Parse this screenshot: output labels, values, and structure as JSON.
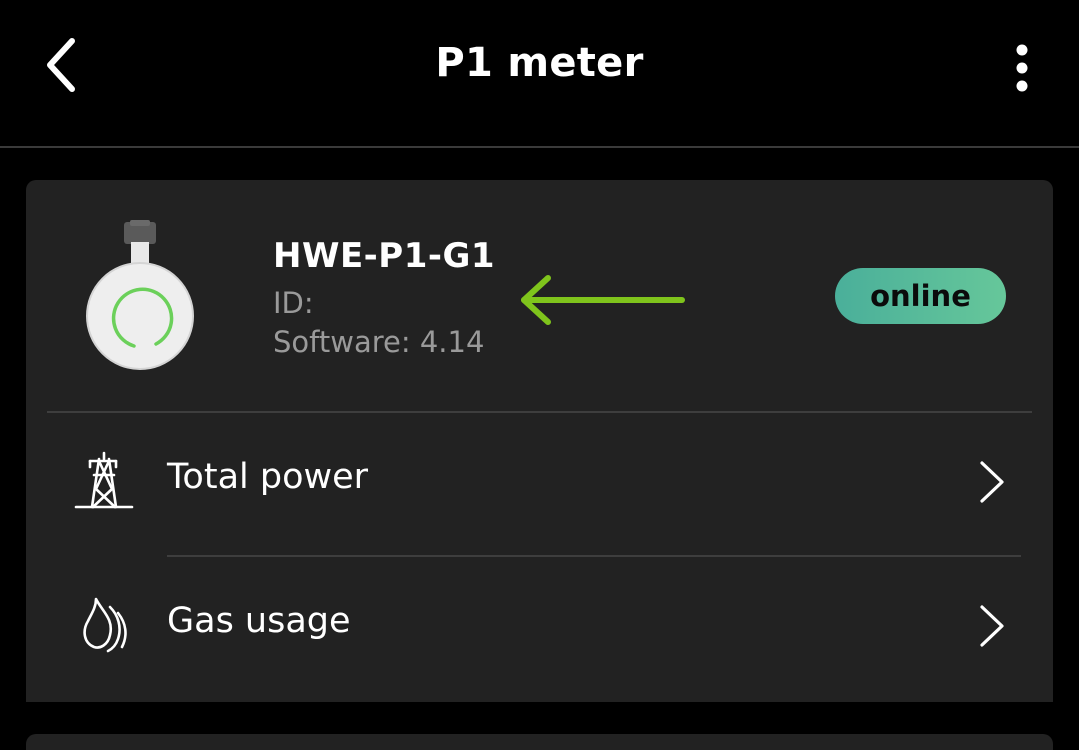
{
  "header": {
    "title": "P1 meter",
    "back_icon": "chevron-left-icon",
    "menu_icon": "more-vertical-icon"
  },
  "device": {
    "name": "HWE-P1-G1",
    "id_label": "ID:",
    "software_label": "Software: 4.14",
    "status": "online",
    "image_icon": "p1-meter-dongle-icon"
  },
  "rows": [
    {
      "label": "Total power",
      "icon": "power-pylon-icon"
    },
    {
      "label": "Gas usage",
      "icon": "gas-flame-icon"
    }
  ],
  "colors": {
    "background": "#000000",
    "card": "#222222",
    "status_badge_start": "#4aaf9a",
    "status_badge_end": "#66c79a",
    "annotation_arrow": "#7fc41c",
    "device_ring": "#6bd05a",
    "muted_text": "#9a9a9a"
  }
}
